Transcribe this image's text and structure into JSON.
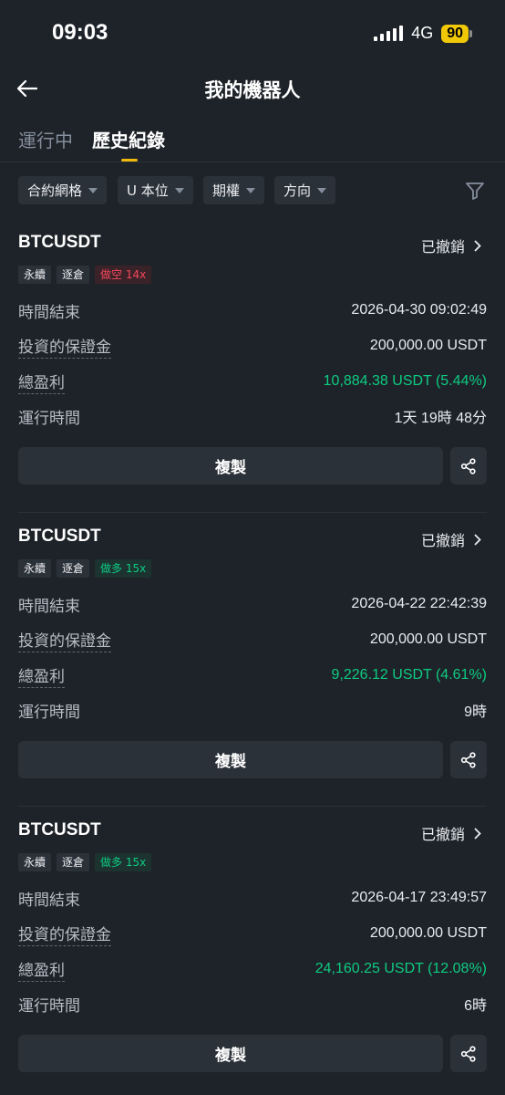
{
  "status_bar": {
    "time": "09:03",
    "network": "4G",
    "battery": "90"
  },
  "header": {
    "title": "我的機器人"
  },
  "tabs": [
    {
      "label": "運行中",
      "active": false
    },
    {
      "label": "歷史紀錄",
      "active": true
    }
  ],
  "filters": [
    {
      "label": "合約網格"
    },
    {
      "label": "U 本位"
    },
    {
      "label": "期權"
    },
    {
      "label": "方向"
    }
  ],
  "colors": {
    "background": "#1e2329",
    "accent": "#f0b90b",
    "positive": "#0ecb81",
    "negative": "#f6465d"
  },
  "bots": [
    {
      "symbol": "BTCUSDT",
      "status": "已撤銷",
      "tags": [
        "永續",
        "逐倉",
        "做空 14x"
      ],
      "end_time_label": "時間結束",
      "end_time": "2026-04-30 09:02:49",
      "margin_label": "投資的保證金",
      "margin": "200,000.00 USDT",
      "pnl_label": "總盈利",
      "pnl": "10,884.38 USDT (5.44%)",
      "runtime_label": "運行時間",
      "runtime": "1天 19時 48分",
      "copy_label": "複製"
    },
    {
      "symbol": "BTCUSDT",
      "status": "已撤銷",
      "tags": [
        "永續",
        "逐倉",
        "做多 15x"
      ],
      "end_time_label": "時間結束",
      "end_time": "2026-04-22 22:42:39",
      "margin_label": "投資的保證金",
      "margin": "200,000.00 USDT",
      "pnl_label": "總盈利",
      "pnl": "9,226.12 USDT (4.61%)",
      "runtime_label": "運行時間",
      "runtime": "9時",
      "copy_label": "複製"
    },
    {
      "symbol": "BTCUSDT",
      "status": "已撤銷",
      "tags": [
        "永續",
        "逐倉",
        "做多 15x"
      ],
      "end_time_label": "時間結束",
      "end_time": "2026-04-17 23:49:57",
      "margin_label": "投資的保證金",
      "margin": "200,000.00 USDT",
      "pnl_label": "總盈利",
      "pnl": "24,160.25 USDT (12.08%)",
      "runtime_label": "運行時間",
      "runtime": "6時",
      "copy_label": "複製"
    }
  ]
}
